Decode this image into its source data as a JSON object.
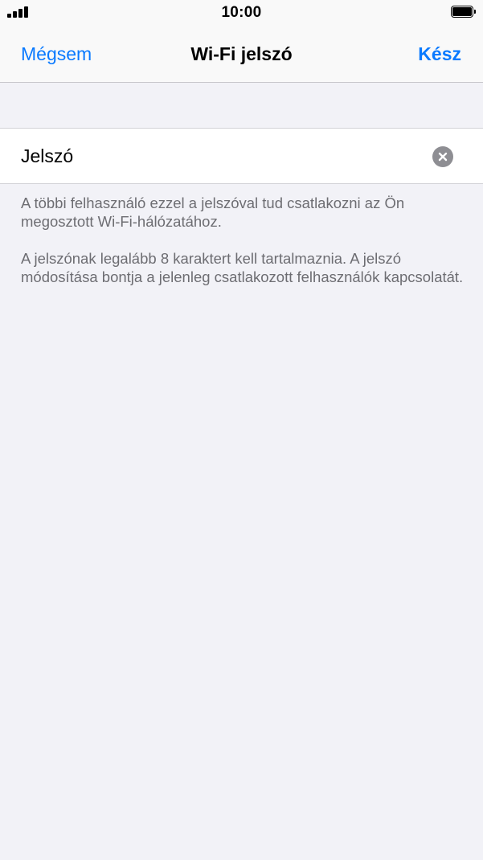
{
  "status_bar": {
    "time": "10:00",
    "icons": [
      "signal-icon",
      "battery-icon"
    ]
  },
  "nav": {
    "cancel_label": "Mégsem",
    "title": "Wi-Fi jelszó",
    "done_label": "Kész"
  },
  "password_field": {
    "value": "Jelszó",
    "clear_icon": "clear-icon"
  },
  "footer": {
    "paragraph_1": "A többi felhasználó ezzel a jelszóval tud csatlakozni az Ön megosztott Wi-Fi-hálózatához.",
    "paragraph_2": "A jelszónak legalább 8 karaktert kell tartalmaznia. A jelszó módosítása bontja a jelenleg csatlakozott felhasználók kapcsolatát."
  },
  "colors": {
    "accent": "#0a7aff",
    "background": "#f2f2f7",
    "footer_text": "#6d6d72",
    "clear_button": "#8e8e93"
  }
}
